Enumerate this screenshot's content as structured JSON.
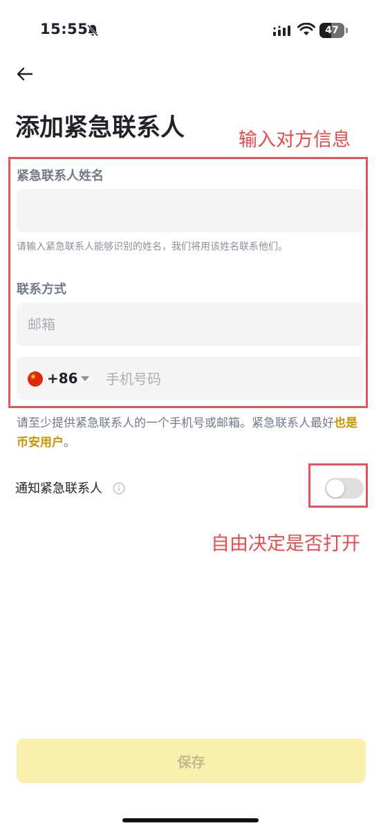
{
  "status_bar": {
    "time": "15:55",
    "battery": "47",
    "battery_level_percent": 47,
    "icons": [
      "bell-slash-icon",
      "signal-icon",
      "wifi-icon",
      "battery-icon"
    ]
  },
  "header": {
    "back_icon": "arrow-left-icon",
    "title": "添加紧急联系人"
  },
  "annotations": {
    "note_inputs": "输入对方信息",
    "note_toggle": "自由决定是否打开",
    "box_color": "#e5535b"
  },
  "form": {
    "name_label": "紧急联系人姓名",
    "name_value": "",
    "name_placeholder": "",
    "name_hint": "请输入紧急联系人能够识别的姓名，我们将用该姓名联系他们。",
    "contact_label": "联系方式",
    "email_value": "",
    "email_placeholder": "邮箱",
    "phone": {
      "flag_icon": "china-flag-icon",
      "country_code": "+86",
      "value": "",
      "placeholder": "手机号码"
    },
    "contact_hint_prefix": "请至少提供紧急联系人的一个手机号或邮箱。紧急联系人最好",
    "contact_hint_link": "也是币安用户",
    "contact_hint_suffix": "。"
  },
  "notify": {
    "label": "通知紧急联系人",
    "info_icon": "info-icon",
    "enabled": false
  },
  "footer": {
    "save_label": "保存"
  },
  "colors": {
    "accent": "#c99400",
    "button_disabled_bg": "#fbefb0",
    "annotation": "#e64b4b"
  }
}
